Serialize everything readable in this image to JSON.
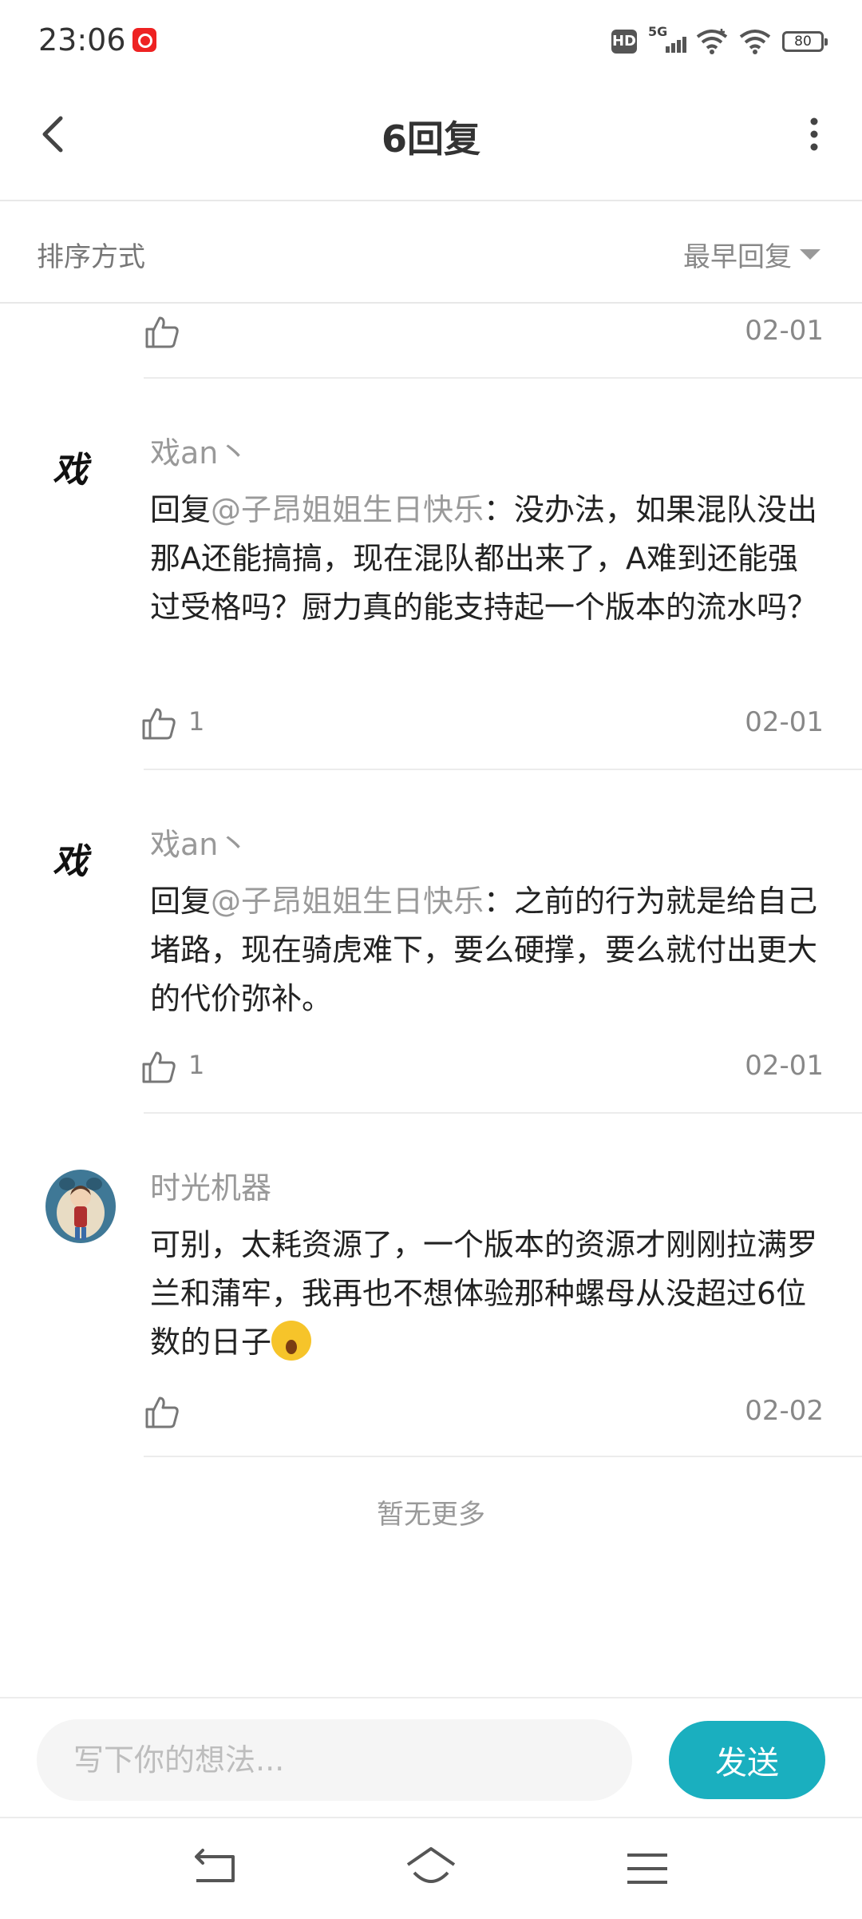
{
  "status_bar": {
    "time": "23:06",
    "hd_label": "HD",
    "network_label": "5G",
    "battery_level": "80",
    "icons": [
      "netease-music-icon",
      "hd-icon",
      "signal-icon",
      "wifi-icon",
      "wifi-icon",
      "battery-icon"
    ]
  },
  "header": {
    "title": "6回复",
    "back_icon": "chevron-left-icon",
    "more_icon": "more-vertical-icon"
  },
  "sort": {
    "label": "排序方式",
    "value": "最早回复"
  },
  "replies": [
    {
      "likes": "",
      "date": "02-01"
    },
    {
      "avatar_text": "戏",
      "username": "戏an丶",
      "prefix": "回复",
      "mention": "@子昂姐姐生日快乐",
      "text": "：没办法，如果混队没出那A还能搞搞，现在混队都出来了，A难到还能强过受格吗？厨力真的能支持起一个版本的流水吗？",
      "likes": "1",
      "date": "02-01"
    },
    {
      "avatar_text": "戏",
      "username": "戏an丶",
      "prefix": "回复",
      "mention": "@子昂姐姐生日快乐",
      "text": "：之前的行为就是给自己堵路，现在骑虎难下，要么硬撑，要么就付出更大的代价弥补。",
      "likes": "1",
      "date": "02-01"
    },
    {
      "username": "时光机器",
      "text": "可别，太耗资源了，一个版本的资源才刚刚拉满罗兰和蒲牢，我再也不想体验那种螺母从没超过6位数的日子",
      "emoji": "shocked-face-emoji",
      "likes": "",
      "date": "02-02"
    }
  ],
  "footer_note": "暂无更多",
  "composer": {
    "placeholder": "写下你的想法...",
    "send_label": "发送"
  },
  "nav_bar": {
    "icons": [
      "back-nav-icon",
      "home-nav-icon",
      "menu-nav-icon"
    ]
  },
  "colors": {
    "accent": "#1aafbf",
    "mention": "#9a9a9a"
  }
}
